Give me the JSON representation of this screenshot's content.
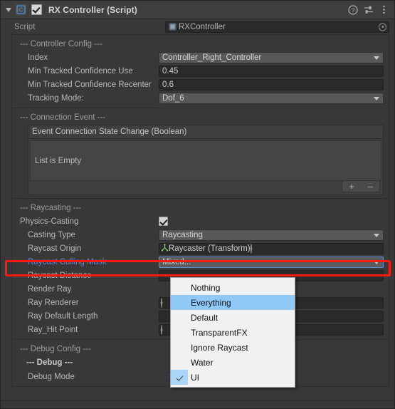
{
  "header": {
    "title": "RX Controller (Script)",
    "enabled_checkbox": true,
    "foldout_icon": "triangle-down-icon",
    "script_icon": "csharp-script-icon",
    "help_icon": "help-icon",
    "preset_icon": "preset-icon",
    "menu_icon": "kebab-menu-icon"
  },
  "script_row": {
    "label": "Script",
    "value": "RXController",
    "picker_icon": "object-picker-icon",
    "type_icon": "script-asset-icon"
  },
  "controller_config": {
    "header": "--- Controller Config ---",
    "fields": [
      {
        "label": "Index",
        "value": "Controller_Right_Controller",
        "kind": "popup"
      },
      {
        "label": "Min Tracked Confidence Use",
        "value": "0.45",
        "kind": "text"
      },
      {
        "label": "Min Tracked Confidence Recenter",
        "value": "0.6",
        "kind": "text"
      },
      {
        "label": "Tracking Mode:",
        "value": "Dof_6",
        "kind": "popup"
      }
    ]
  },
  "connection_event": {
    "header": "--- Connection Event ---",
    "event_title": "Event Connection State Change (Boolean)",
    "empty_text": "List is Empty",
    "add_label": "+",
    "remove_label": "–"
  },
  "raycasting": {
    "header": "--- Raycasting ---",
    "physics_casting": {
      "label": "Physics-Casting",
      "checked": true
    },
    "fields": [
      {
        "label": "Casting Type",
        "value": "Raycasting",
        "kind": "popup"
      },
      {
        "label": "Raycast Origin",
        "value": "Raycaster (Transform)",
        "kind": "object"
      },
      {
        "label": "Raycast Culling Mask",
        "value": "Mixed...",
        "kind": "popup-focused",
        "highlighted": true
      },
      {
        "label": "Raycast Distance",
        "value": "",
        "kind": "text"
      },
      {
        "label": "Render Ray",
        "value": "",
        "kind": "blank"
      },
      {
        "label": "Ray Renderer",
        "value": "",
        "kind": "object-empty"
      },
      {
        "label": "Ray Default Length",
        "value": "",
        "kind": "text"
      },
      {
        "label": "Ray_Hit Point",
        "value": "",
        "kind": "object-empty"
      }
    ]
  },
  "debug_config": {
    "header": "--- Debug Config ---",
    "sub_header": "--- Debug ---",
    "debug_mode": {
      "label": "Debug Mode",
      "checked": false
    }
  },
  "culling_mask_menu": {
    "items": [
      {
        "label": "Nothing",
        "checked": false,
        "selected": false
      },
      {
        "label": "Everything",
        "checked": false,
        "selected": true
      },
      {
        "label": "Default",
        "checked": false,
        "selected": false
      },
      {
        "label": "TransparentFX",
        "checked": false,
        "selected": false
      },
      {
        "label": "Ignore Raycast",
        "checked": false,
        "selected": false
      },
      {
        "label": "Water",
        "checked": false,
        "selected": false
      },
      {
        "label": "UI",
        "checked": true,
        "selected": false
      }
    ]
  },
  "colors": {
    "panel_bg": "#383838",
    "header_bg": "#3e3e3e",
    "field_bg": "#2a2a2a",
    "popup_bg": "#585858",
    "accent_blue": "#5b8fd8",
    "highlight_red": "#ff1a10",
    "menu_bg": "#f1f1f1",
    "menu_select": "#90c8f6",
    "label_link": "#5a8fd8"
  }
}
